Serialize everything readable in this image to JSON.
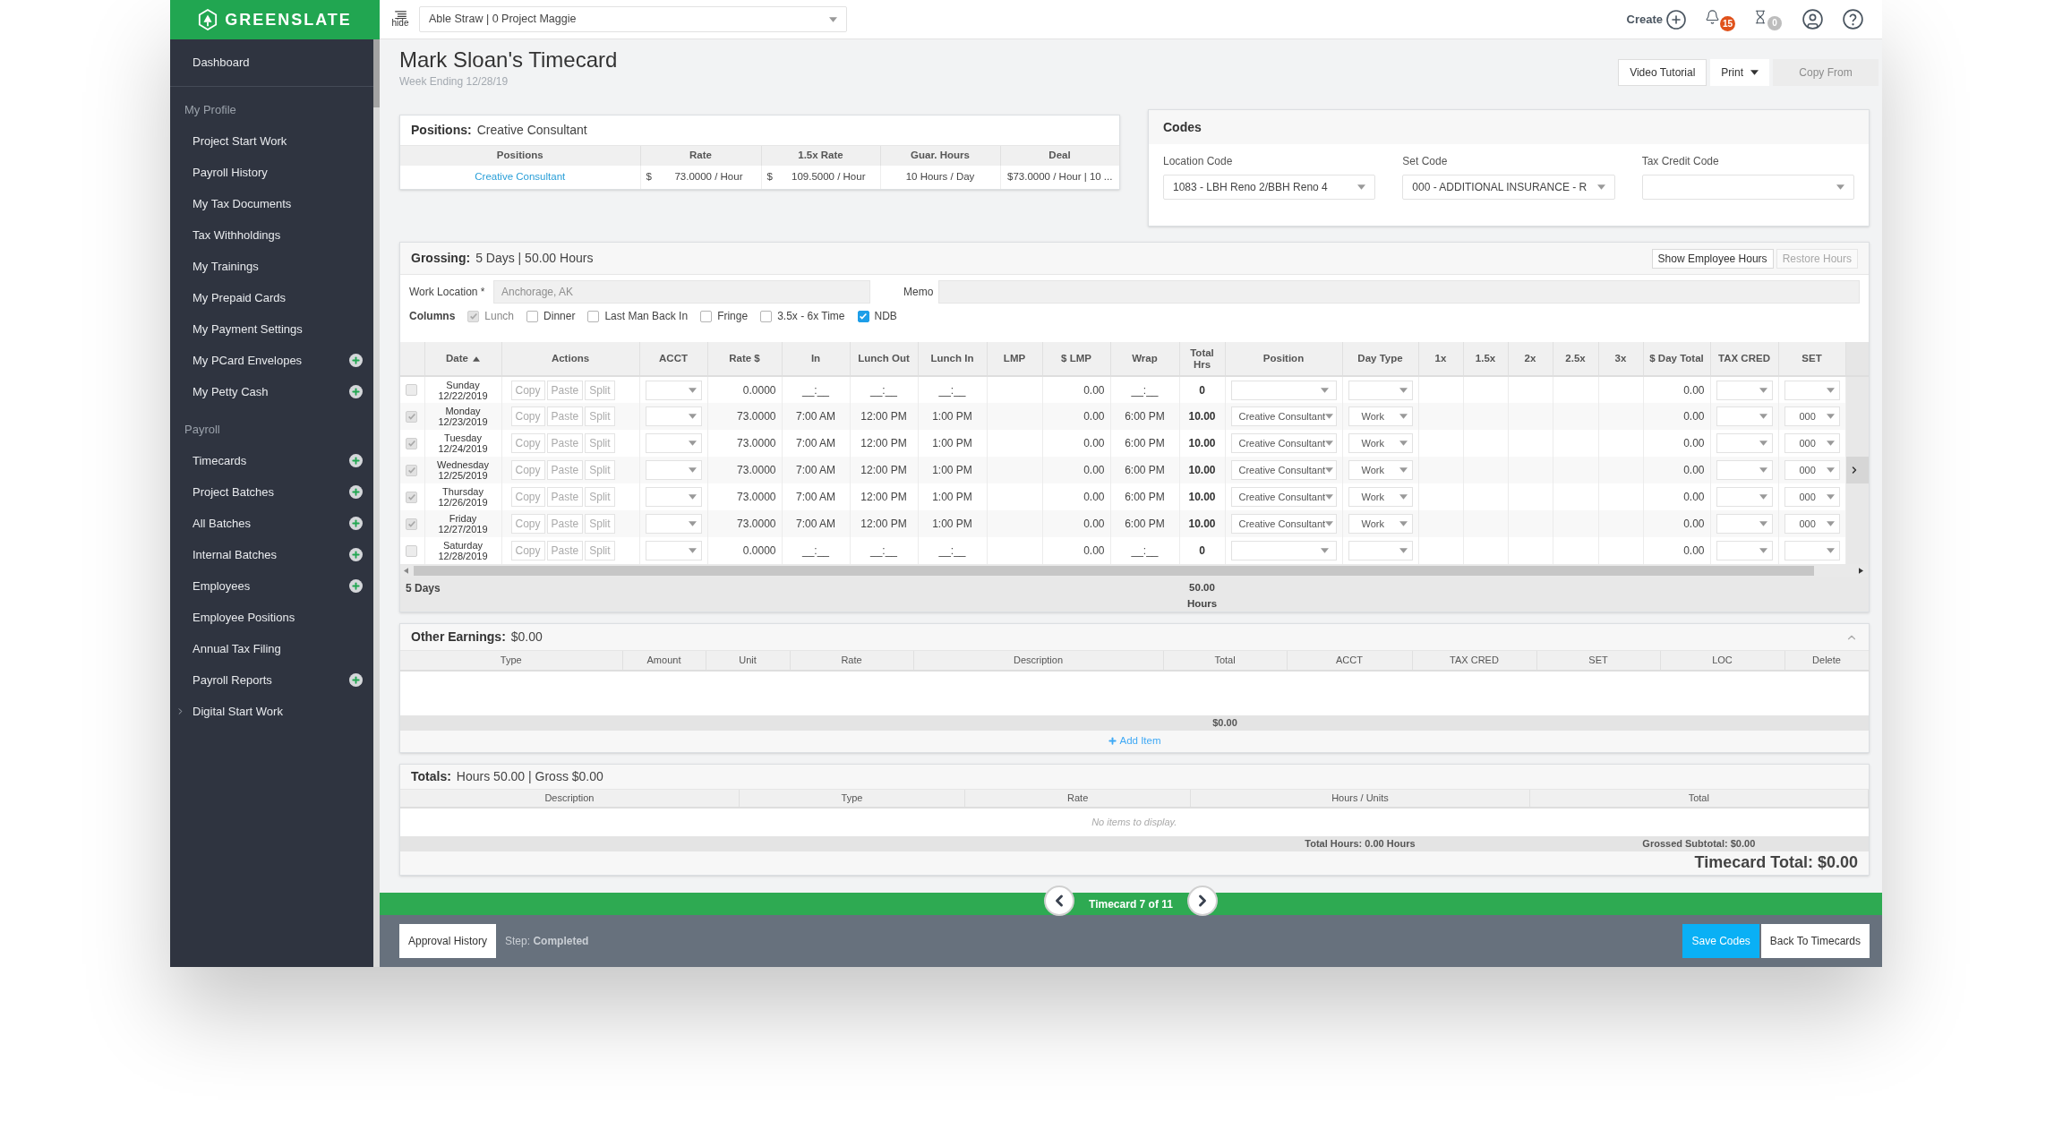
{
  "sidebar": {
    "logo": "GREENSLATE",
    "items": [
      {
        "kind": "link",
        "label": "Dashboard",
        "add": false,
        "expandable": false
      },
      {
        "kind": "heading",
        "label": "My Profile",
        "divider": true
      },
      {
        "kind": "link",
        "label": "Project Start Work",
        "add": false,
        "expandable": false
      },
      {
        "kind": "link",
        "label": "Payroll History",
        "add": false,
        "expandable": false
      },
      {
        "kind": "link",
        "label": "My Tax Documents",
        "add": false,
        "expandable": false
      },
      {
        "kind": "link",
        "label": "Tax Withholdings",
        "add": false,
        "expandable": false
      },
      {
        "kind": "link",
        "label": "My Trainings",
        "add": false,
        "expandable": false
      },
      {
        "kind": "link",
        "label": "My Prepaid Cards",
        "add": false,
        "expandable": false
      },
      {
        "kind": "link",
        "label": "My Payment Settings",
        "add": false,
        "expandable": false
      },
      {
        "kind": "link",
        "label": "My PCard Envelopes",
        "add": true,
        "expandable": false
      },
      {
        "kind": "link",
        "label": "My Petty Cash",
        "add": true,
        "expandable": false
      },
      {
        "kind": "heading",
        "label": "Payroll",
        "divider": false
      },
      {
        "kind": "link",
        "label": "Timecards",
        "add": true,
        "expandable": false
      },
      {
        "kind": "link",
        "label": "Project Batches",
        "add": true,
        "expandable": false
      },
      {
        "kind": "link",
        "label": "All Batches",
        "add": true,
        "expandable": false
      },
      {
        "kind": "link",
        "label": "Internal Batches",
        "add": true,
        "expandable": false
      },
      {
        "kind": "link",
        "label": "Employees",
        "add": true,
        "expandable": false
      },
      {
        "kind": "link",
        "label": "Employee Positions",
        "add": false,
        "expandable": false
      },
      {
        "kind": "link",
        "label": "Annual Tax Filing",
        "add": false,
        "expandable": false
      },
      {
        "kind": "link",
        "label": "Payroll Reports",
        "add": true,
        "expandable": false
      },
      {
        "kind": "link",
        "label": "Digital Start Work",
        "add": false,
        "expandable": true
      }
    ]
  },
  "topbar": {
    "hide_label": "hide",
    "project": "Able Straw | 0 Project Maggie",
    "create_label": "Create",
    "notifications_badge": "15",
    "pending_badge": "0"
  },
  "page": {
    "title": "Mark Sloan's Timecard",
    "subtitle": "Week Ending 12/28/19",
    "buttons": [
      {
        "label": "Video Tutorial",
        "kind": "plain",
        "disabled": false
      },
      {
        "label": "Print",
        "kind": "dropdown",
        "disabled": false
      },
      {
        "label": "Copy From",
        "kind": "plain",
        "disabled": true
      }
    ]
  },
  "positions": {
    "label": "Positions:",
    "value": "Creative Consultant",
    "columns": [
      "Positions",
      "Rate",
      "1.5x Rate",
      "Guar. Hours",
      "Deal"
    ],
    "rows": [
      {
        "position": "Creative Consultant",
        "rate_currency": "$",
        "rate": "73.0000 / Hour",
        "rate_15_currency": "$",
        "rate_15": "109.5000 / Hour",
        "guar_hours": "10 Hours / Day",
        "deal": "$73.0000 / Hour | 10 ..."
      }
    ]
  },
  "codes": {
    "title": "Codes",
    "fields": [
      {
        "label": "Location Code",
        "value": "1083 - LBH Reno 2/BBH Reno 4"
      },
      {
        "label": "Set Code",
        "value": "000 - ADDITIONAL INSURANCE - R"
      },
      {
        "label": "Tax Credit Code"
      }
    ]
  },
  "grossing": {
    "label": "Grossing:",
    "summary": "5 Days | 50.00 Hours",
    "buttons": [
      {
        "label": "Show Employee Hours",
        "disabled": false
      },
      {
        "label": "Restore Hours",
        "disabled": true
      }
    ],
    "work_location": {
      "label": "Work Location *",
      "placeholder": "Anchorage, AK"
    },
    "memo": {
      "label": "Memo"
    },
    "columns_label": "Columns",
    "column_toggles": [
      {
        "label": "Lunch",
        "checked": true,
        "disabled": true
      },
      {
        "label": "Dinner",
        "checked": false,
        "disabled": false
      },
      {
        "label": "Last Man Back In",
        "checked": false,
        "disabled": false
      },
      {
        "label": "Fringe",
        "checked": false,
        "disabled": false
      },
      {
        "label": "3.5x - 6x Time",
        "checked": false,
        "disabled": false
      },
      {
        "label": "NDB",
        "checked": true,
        "disabled": false
      }
    ],
    "columns": [
      {
        "label": "Date",
        "sorted": true
      },
      {
        "label": "Actions",
        "sorted": false
      },
      {
        "label": "ACCT",
        "sorted": false
      },
      {
        "label": "Rate $",
        "sorted": false
      },
      {
        "label": "In",
        "sorted": false
      },
      {
        "label": "Lunch Out",
        "sorted": false
      },
      {
        "label": "Lunch In",
        "sorted": false
      },
      {
        "label": "LMP",
        "sorted": false
      },
      {
        "label": "$ LMP",
        "sorted": false
      },
      {
        "label": "Wrap",
        "sorted": false
      },
      {
        "label": "Total Hrs",
        "sorted": false
      },
      {
        "label": "Position",
        "sorted": false
      },
      {
        "label": "Day Type",
        "sorted": false
      },
      {
        "label": "1x",
        "sorted": false
      },
      {
        "label": "1.5x",
        "sorted": false
      },
      {
        "label": "2x",
        "sorted": false
      },
      {
        "label": "2.5x",
        "sorted": false
      },
      {
        "label": "3x",
        "sorted": false
      },
      {
        "label": "$ Day Total",
        "sorted": false
      },
      {
        "label": "TAX CRED",
        "sorted": false
      },
      {
        "label": "SET",
        "sorted": false
      }
    ],
    "rows": [
      {
        "checked": false,
        "day": "Sunday",
        "date": "12/22/2019",
        "actions": [
          "Copy",
          "Paste",
          "Split"
        ],
        "rate": "0.0000",
        "in": "__:__",
        "lunch_out": "__:__",
        "lunch_in": "__:__",
        "lmp_amount": "0.00",
        "wrap": "__:__",
        "total_hrs": "0",
        "day_total": "0.00",
        "current": false
      },
      {
        "checked": true,
        "day": "Monday",
        "date": "12/23/2019",
        "actions": [
          "Copy",
          "Paste",
          "Split"
        ],
        "rate": "73.0000",
        "in": "7:00 AM",
        "lunch_out": "12:00 PM",
        "lunch_in": "1:00 PM",
        "lmp_amount": "0.00",
        "wrap": "6:00 PM",
        "total_hrs": "10.00",
        "position": "Creative Consultant",
        "day_type": "Work",
        "day_total": "0.00",
        "set": "000",
        "current": false
      },
      {
        "checked": true,
        "day": "Tuesday",
        "date": "12/24/2019",
        "actions": [
          "Copy",
          "Paste",
          "Split"
        ],
        "rate": "73.0000",
        "in": "7:00 AM",
        "lunch_out": "12:00 PM",
        "lunch_in": "1:00 PM",
        "lmp_amount": "0.00",
        "wrap": "6:00 PM",
        "total_hrs": "10.00",
        "position": "Creative Consultant",
        "day_type": "Work",
        "day_total": "0.00",
        "set": "000",
        "current": false
      },
      {
        "checked": true,
        "day": "Wednesday",
        "date": "12/25/2019",
        "actions": [
          "Copy",
          "Paste",
          "Split"
        ],
        "rate": "73.0000",
        "in": "7:00 AM",
        "lunch_out": "12:00 PM",
        "lunch_in": "1:00 PM",
        "lmp_amount": "0.00",
        "wrap": "6:00 PM",
        "total_hrs": "10.00",
        "position": "Creative Consultant",
        "day_type": "Work",
        "day_total": "0.00",
        "set": "000",
        "current": true
      },
      {
        "checked": true,
        "day": "Thursday",
        "date": "12/26/2019",
        "actions": [
          "Copy",
          "Paste",
          "Split"
        ],
        "rate": "73.0000",
        "in": "7:00 AM",
        "lunch_out": "12:00 PM",
        "lunch_in": "1:00 PM",
        "lmp_amount": "0.00",
        "wrap": "6:00 PM",
        "total_hrs": "10.00",
        "position": "Creative Consultant",
        "day_type": "Work",
        "day_total": "0.00",
        "set": "000",
        "current": false
      },
      {
        "checked": true,
        "day": "Friday",
        "date": "12/27/2019",
        "actions": [
          "Copy",
          "Paste",
          "Split"
        ],
        "rate": "73.0000",
        "in": "7:00 AM",
        "lunch_out": "12:00 PM",
        "lunch_in": "1:00 PM",
        "lmp_amount": "0.00",
        "wrap": "6:00 PM",
        "total_hrs": "10.00",
        "position": "Creative Consultant",
        "day_type": "Work",
        "day_total": "0.00",
        "set": "000",
        "current": false
      },
      {
        "checked": false,
        "day": "Saturday",
        "date": "12/28/2019",
        "actions": [
          "Copy",
          "Paste",
          "Split"
        ],
        "rate": "0.0000",
        "in": "__:__",
        "lunch_out": "__:__",
        "lunch_in": "__:__",
        "lmp_amount": "0.00",
        "wrap": "__:__",
        "total_hrs": "0",
        "day_total": "0.00",
        "current": false
      }
    ],
    "footer": {
      "days": "5 Days",
      "hours": "50.00 Hours"
    }
  },
  "other_earnings": {
    "label": "Other Earnings:",
    "summary": "$0.00",
    "expanded": true,
    "columns": [
      "Type",
      "Amount",
      "Unit",
      "Rate",
      "Description",
      "Total",
      "ACCT",
      "TAX CRED",
      "SET",
      "LOC",
      "Delete"
    ],
    "footer_total": "$0.00",
    "add_item": "Add Item"
  },
  "totals": {
    "label": "Totals:",
    "summary": "Hours 50.00 | Gross $0.00",
    "columns": [
      "Description",
      "Type",
      "Rate",
      "Hours / Units",
      "Total"
    ],
    "empty_text": "No items to display.",
    "total_hours": "Total Hours: 0.00 Hours",
    "grossed_subtotal": "Grossed Subtotal: $0.00",
    "timecard_total": "Timecard Total: $0.00"
  },
  "pager": {
    "label": "Timecard 7 of 11"
  },
  "footer": {
    "approval_button": "Approval History",
    "step": "Step: **Completed**",
    "buttons": [
      {
        "label": "Save Codes",
        "kind": "primary"
      },
      {
        "label": "Back To Timecards",
        "kind": "default"
      }
    ]
  }
}
